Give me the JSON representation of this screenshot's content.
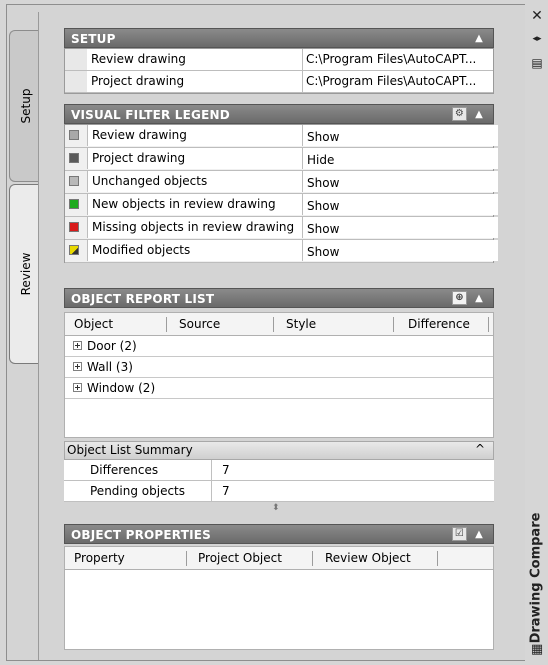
{
  "tabs": {
    "setup": "Setup",
    "review": "Review"
  },
  "palette_title": "Drawing Compare",
  "right_strip": {
    "close_glyph": "✕",
    "autohide_glyph": "◂▸",
    "properties_glyph": "▤"
  },
  "setup": {
    "title": "SETUP",
    "rows": [
      {
        "label": "Review drawing",
        "value": "C:\\Program Files\\AutoCAPT..."
      },
      {
        "label": "Project drawing",
        "value": "C:\\Program Files\\AutoCAPT..."
      }
    ]
  },
  "legend": {
    "title": "VISUAL FILTER LEGEND",
    "rows": [
      {
        "label": "Review drawing",
        "value": "Show",
        "color": "#a8a8a8"
      },
      {
        "label": "Project drawing",
        "value": "Hide",
        "color": "#5a5a5a"
      },
      {
        "label": "Unchanged objects",
        "value": "Show",
        "color": "#b8b8b8"
      },
      {
        "label": "New objects in review drawing",
        "value": "Show",
        "color": "#1faa1f"
      },
      {
        "label": "Missing objects in review drawing",
        "value": "Show",
        "color": "#d81a1a"
      },
      {
        "label": "Modified objects",
        "value": "Show",
        "color": "#e8d800"
      }
    ]
  },
  "report": {
    "title": "OBJECT REPORT LIST",
    "columns": [
      "Object",
      "Source",
      "Style",
      "Difference"
    ],
    "items": [
      "Door (2)",
      "Wall (3)",
      "Window (2)"
    ]
  },
  "summary": {
    "title": "Object List Summary",
    "chevron": "^",
    "rows": [
      {
        "label": "Differences",
        "value": "7"
      },
      {
        "label": "Pending objects",
        "value": "7"
      }
    ]
  },
  "splitter_glyph": "⬍",
  "properties": {
    "title": "OBJECT PROPERTIES",
    "columns": [
      "Property",
      "Project Object",
      "Review Object"
    ]
  },
  "collapse_glyph": "▲"
}
